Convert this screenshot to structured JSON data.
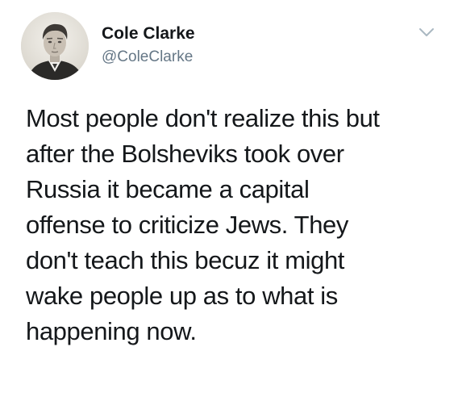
{
  "author": {
    "display_name": "Cole Clarke",
    "handle": "@ColeClarke",
    "avatar_icon": "vintage-portrait-photo"
  },
  "menu": {
    "icon": "chevron-down-icon"
  },
  "tweet": {
    "lines": [
      "Most people don't realize this but",
      "after the Bolsheviks took over",
      "Russia it became a capital",
      "offense to criticize Jews. They",
      "don't teach this becuz it might",
      "wake people up as to what is",
      "happening now."
    ]
  },
  "colors": {
    "text": "#14171a",
    "secondary_text": "#657786",
    "background": "#ffffff"
  }
}
